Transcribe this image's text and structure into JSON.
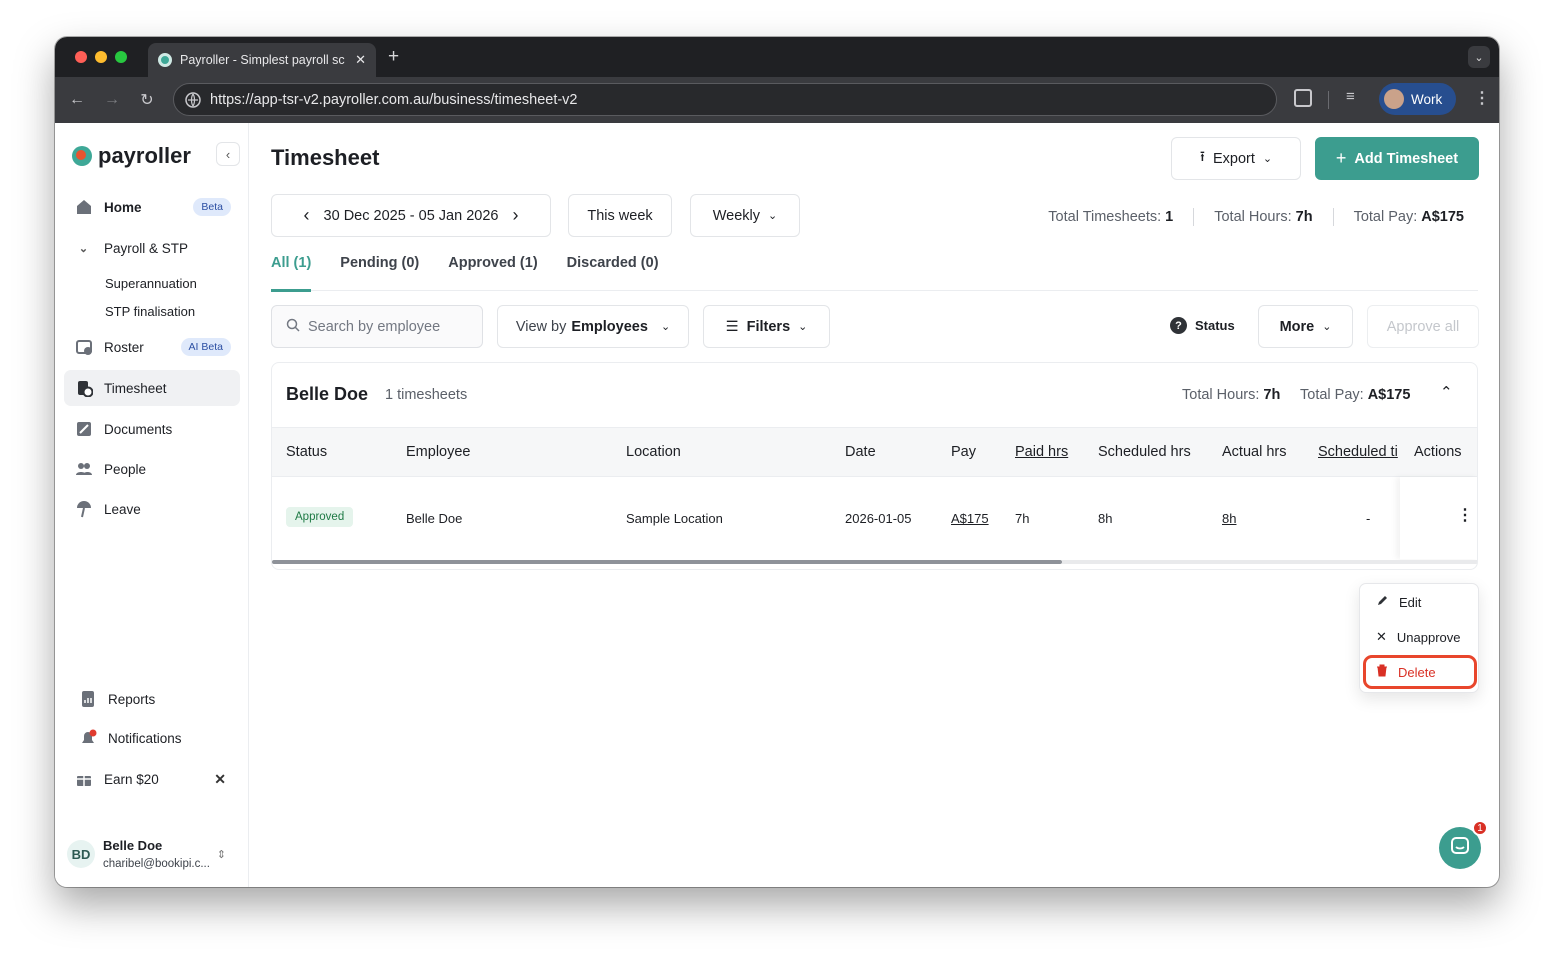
{
  "browser": {
    "tab_title": "Payroller - Simplest payroll sc",
    "url": "https://app-tsr-v2.payroller.com.au/business/timesheet-v2",
    "profile_label": "Work",
    "colors": {
      "close": "#ff5f57",
      "minimize": "#febc2e",
      "maximize": "#28c840"
    }
  },
  "sidebar": {
    "logo": "payroller",
    "items": [
      {
        "label": "Home",
        "badge": "Beta",
        "icon": "home-icon"
      },
      {
        "label": "Payroll & STP",
        "icon": "chevron-down-icon"
      },
      {
        "label": "Superannuation"
      },
      {
        "label": "STP finalisation"
      },
      {
        "label": "Roster",
        "badge": "AI Beta",
        "icon": "roster-icon"
      },
      {
        "label": "Timesheet",
        "icon": "timesheet-icon"
      },
      {
        "label": "Documents",
        "icon": "documents-icon"
      },
      {
        "label": "People",
        "icon": "people-icon"
      },
      {
        "label": "Leave",
        "icon": "leave-icon"
      }
    ],
    "bottom": [
      {
        "label": "Reports",
        "icon": "reports-icon"
      },
      {
        "label": "Notifications",
        "icon": "bell-icon"
      },
      {
        "label": "Earn $20",
        "icon": "gift-icon"
      }
    ],
    "user": {
      "initials": "BD",
      "name": "Belle Doe",
      "email": "charibel@bookipi.c..."
    }
  },
  "header": {
    "title": "Timesheet",
    "export_label": "Export",
    "add_label": "Add Timesheet",
    "date_range": "30 Dec 2025 - 05 Jan 2026",
    "this_week": "This week",
    "period": "Weekly",
    "stats": [
      {
        "label": "Total Timesheets: ",
        "value": "1"
      },
      {
        "label": "Total Hours: ",
        "value": "7h"
      },
      {
        "label": "Total Pay: ",
        "value": "A$175"
      }
    ]
  },
  "tabs": [
    "All (1)",
    "Pending (0)",
    "Approved (1)",
    "Discarded (0)"
  ],
  "toolbar": {
    "search_placeholder": "Search by employee",
    "view_by_prefix": "View by",
    "view_by_value": "Employees",
    "filters": "Filters",
    "status": "Status",
    "more": "More",
    "approve_all": "Approve all"
  },
  "group": {
    "name": "Belle Doe",
    "count": "1 timesheets",
    "hours_label": "Total Hours: ",
    "hours": "7h",
    "pay_label": "Total Pay: ",
    "pay": "A$175"
  },
  "table": {
    "columns": [
      "Status",
      "Employee",
      "Location",
      "Date",
      "Pay",
      "Paid hrs",
      "Scheduled hrs",
      "Actual hrs",
      "Scheduled ti",
      "Actions"
    ],
    "row": {
      "status": "Approved",
      "employee": "Belle Doe",
      "location": "Sample Location",
      "date": "2026-01-05",
      "pay": "A$175",
      "paid_hrs": "7h",
      "scheduled_hrs": "8h",
      "actual_hrs": "8h",
      "scheduled_time": "-"
    }
  },
  "menu": {
    "edit": "Edit",
    "unapprove": "Unapprove",
    "delete": "Delete"
  },
  "chat": {
    "unread": "1"
  }
}
